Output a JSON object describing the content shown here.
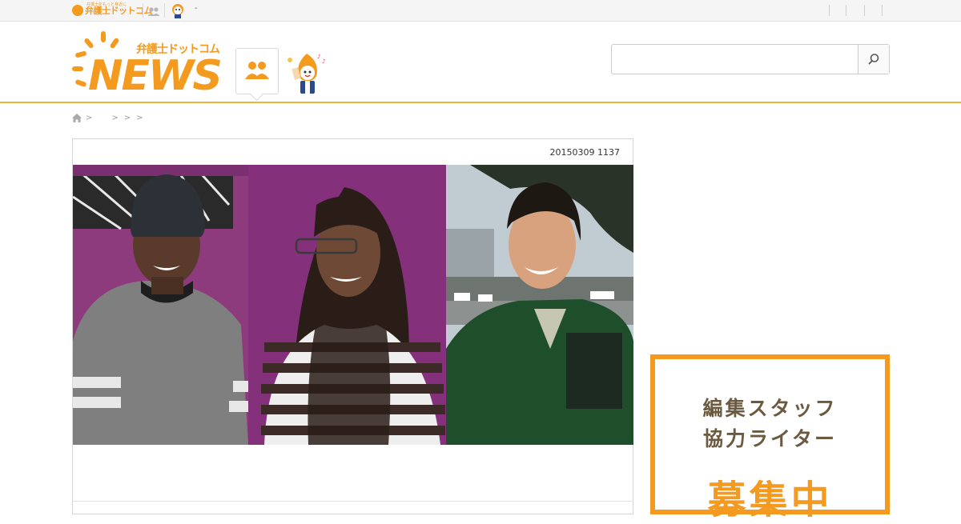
{
  "topbar": {
    "logo_tagline": "弁護士をもっと身近に",
    "logo_text": "弁護士ドットコム",
    "dash": "-"
  },
  "header": {
    "logo_small": "弁護士ドットコム",
    "logo_big": "NEWS",
    "search_placeholder": ""
  },
  "breadcrumb": {
    "separators": [
      ">",
      ">",
      ">",
      ">"
    ]
  },
  "article": {
    "date": "20150309 1137"
  },
  "ad": {
    "line1": "編集スタッフ",
    "line2": "協力ライター",
    "line3": "募集中"
  },
  "colors": {
    "brand_orange": "#f39a1f",
    "header_rule": "#f0b43a",
    "ad_text": "#6b5a40"
  },
  "icons": [
    "sun-logo-icon",
    "people-icon",
    "mascot-icon",
    "search-icon",
    "home-icon"
  ]
}
